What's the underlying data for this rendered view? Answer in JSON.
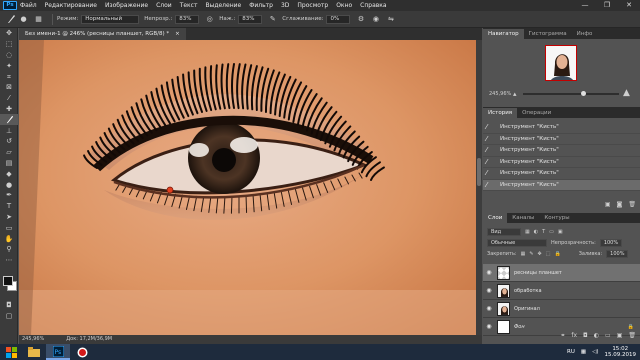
{
  "app": {
    "logo": "Ps"
  },
  "menu": [
    "Файл",
    "Редактирование",
    "Изображение",
    "Слои",
    "Текст",
    "Выделение",
    "Фильтр",
    "3D",
    "Просмотр",
    "Окно",
    "Справка"
  ],
  "window_controls": [
    "—",
    "❐",
    "✕"
  ],
  "options_bar": {
    "mode_label": "Режим:",
    "mode_value": "Нормальный",
    "opacity_label": "Непрозр.:",
    "opacity_value": "83%",
    "flow_label": "Наж.:",
    "flow_value": "83%",
    "smoothing_label": "Сглаживание:",
    "smoothing_value": "0%",
    "icons": [
      "brush-icon",
      "brush-presets-icon",
      "airbrush-icon",
      "settings-gear-icon",
      "symmetry-icon"
    ]
  },
  "document": {
    "tab_title": "Без имени-1 @ 246% (ресницы планшет, RGB/8) *",
    "tab_close": "×",
    "status_zoom": "245,96%",
    "status_info": "Док: 17,2M/36,9M"
  },
  "tools": [
    "move-icon",
    "marquee-icon",
    "lasso-icon",
    "quick-select-icon",
    "crop-icon",
    "frame-icon",
    "eyedropper-icon",
    "healing-icon",
    "brush-icon",
    "stamp-icon",
    "history-brush-icon",
    "eraser-icon",
    "gradient-icon",
    "blur-icon",
    "dodge-icon",
    "pen-icon",
    "type-icon",
    "path-select-icon",
    "shape-icon",
    "hand-icon",
    "zoom-icon",
    "more-icon"
  ],
  "panels": {
    "top_tabs": [
      "Навигатор",
      "Гистограмма",
      "Инфо"
    ],
    "navigator": {
      "zoom": "245,96%"
    },
    "history_tabs": [
      "История",
      "Операции"
    ],
    "history_items": [
      "Инструмент \"Кисть\"",
      "Инструмент \"Кисть\"",
      "Инструмент \"Кисть\"",
      "Инструмент \"Кисть\"",
      "Инструмент \"Кисть\"",
      "Инструмент \"Кисть\""
    ],
    "layers_tabs": [
      "Слои",
      "Каналы",
      "Контуры"
    ],
    "layers_filter": "Вид",
    "blend_mode": "Обычные",
    "opacity_label": "Непрозрачность:",
    "opacity_value": "100%",
    "lock_label": "Закрепить:",
    "fill_label": "Заливка:",
    "fill_value": "100%",
    "layers": [
      {
        "name": "ресницы планшет",
        "selected": true,
        "thumb": "checker"
      },
      {
        "name": "обработка",
        "selected": false,
        "thumb": "portrait"
      },
      {
        "name": "Оригинал",
        "selected": false,
        "thumb": "portrait"
      },
      {
        "name": "Фон",
        "selected": false,
        "thumb": "white"
      }
    ]
  },
  "taskbar": {
    "apps": [
      "start-icon",
      "explorer-icon",
      "photoshop-icon",
      "recorder-icon"
    ],
    "language": "RU",
    "time": "15:02",
    "date": "15.09.2019"
  }
}
